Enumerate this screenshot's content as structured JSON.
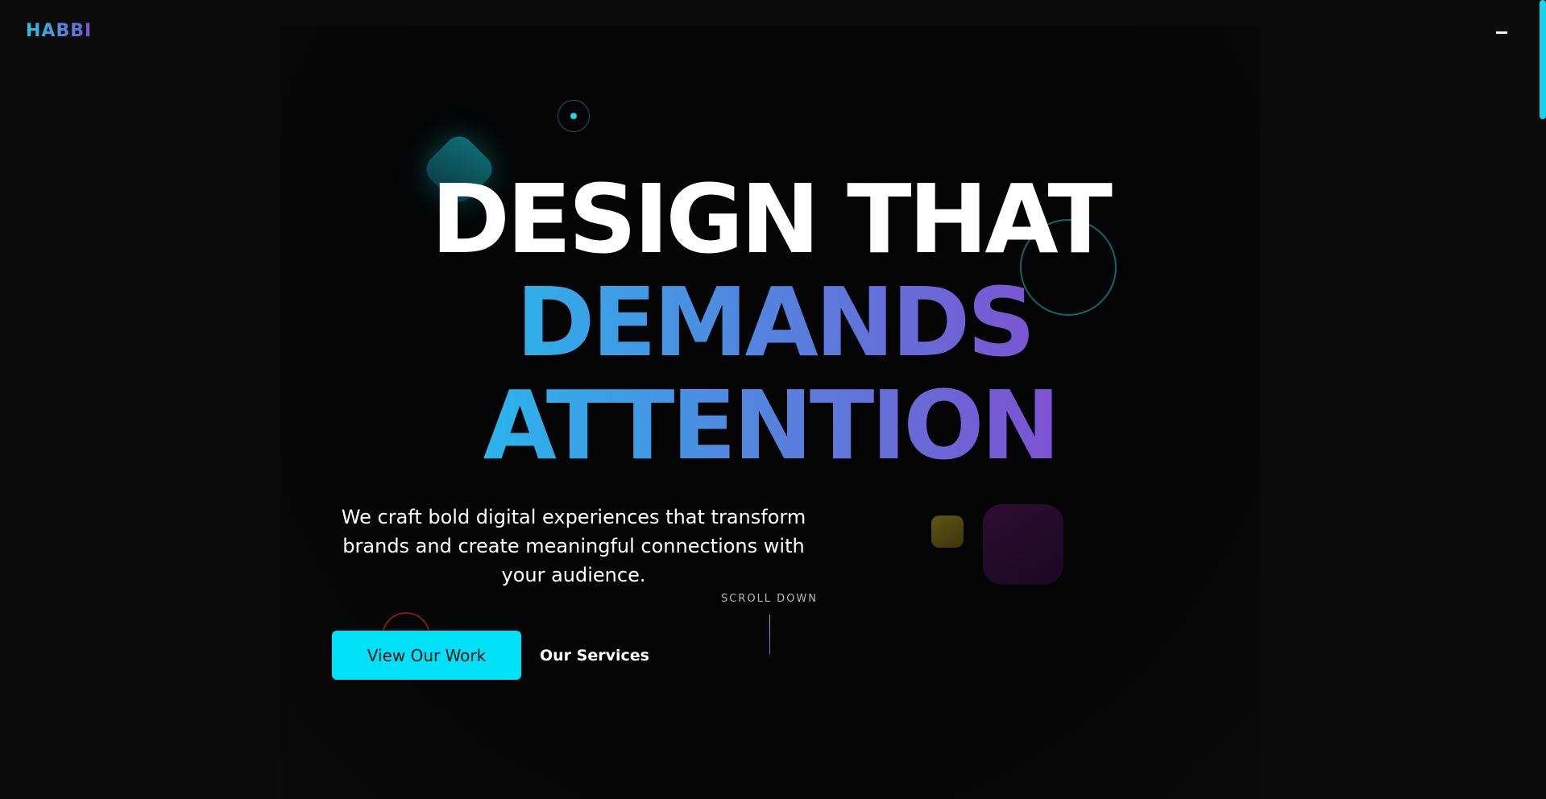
{
  "header": {
    "logo": "HABBI",
    "menu_icon": "hamburger-icon"
  },
  "hero": {
    "headline": {
      "line1": "DESIGN THAT",
      "line2": "DEMANDS",
      "line3": "ATTENTION"
    },
    "subtitle": "We craft bold digital experiences that transform brands and create meaningful connections with your audience.",
    "primary_button": "View Our Work",
    "secondary_button": "Our Services",
    "scroll_label": "SCROLL DOWN"
  },
  "colors": {
    "accent": "#00e1f7",
    "gradient_start": "#0ad8f5",
    "gradient_end": "#9a2fc8",
    "background": "#0b0b0c"
  }
}
